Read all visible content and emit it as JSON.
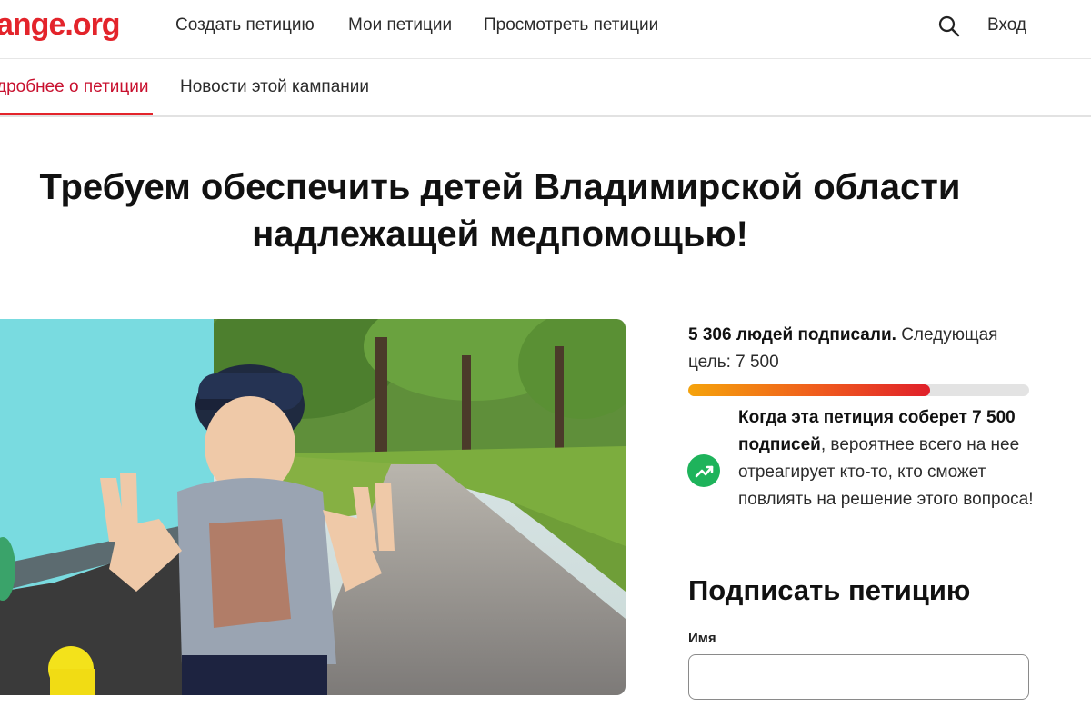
{
  "header": {
    "logo": "ange.org",
    "nav": [
      "Создать петицию",
      "Мои петиции",
      "Просмотреть петиции"
    ],
    "search_icon": "search-icon",
    "login": "Вход"
  },
  "tabs": {
    "details": "дробнее о петиции",
    "news": "Новости этой кампании"
  },
  "petition": {
    "title_line1": "Требуем обеспечить детей Владимирской области",
    "title_line2": "надлежащей медпомощью!",
    "photo_icon": "petition-photo"
  },
  "progress": {
    "count_bold": "5 306 людей подписали.",
    "next_label": "Следующая цель: 7 500",
    "signatures": 5306,
    "goal": 7500,
    "fraction": 0.71
  },
  "goal_note": {
    "bold": "Когда эта петиция соберет 7 500 подписей",
    "rest": ", вероятнее всего на нее отреагирует кто-то, кто сможет повлиять на решение этого вопроса!",
    "icon": "trending-up-icon"
  },
  "sign": {
    "title": "Подписать петицию",
    "name_label": "Имя",
    "name_value": ""
  },
  "colors": {
    "brand": "#e3242b",
    "progress_start": "#f5a30b",
    "progress_end": "#e0202a",
    "trend_badge": "#1eb35b"
  }
}
